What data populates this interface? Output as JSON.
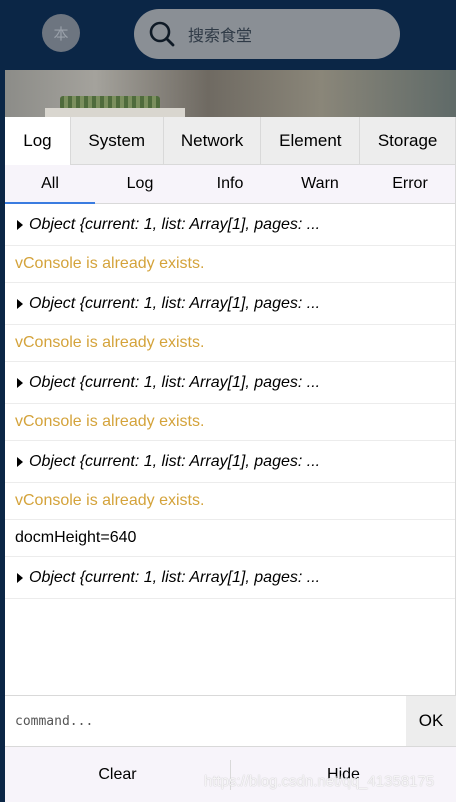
{
  "header": {
    "avatar_glyph": "本",
    "search": {
      "placeholder": "搜索食堂",
      "icon": "search-icon"
    }
  },
  "vconsole": {
    "tabs": [
      {
        "label": "Log",
        "active": true
      },
      {
        "label": "System",
        "active": false
      },
      {
        "label": "Network",
        "active": false
      },
      {
        "label": "Element",
        "active": false
      },
      {
        "label": "Storage",
        "active": false
      }
    ],
    "subtabs": [
      {
        "label": "All",
        "active": true
      },
      {
        "label": "Log",
        "active": false
      },
      {
        "label": "Info",
        "active": false
      },
      {
        "label": "Warn",
        "active": false
      },
      {
        "label": "Error",
        "active": false
      }
    ],
    "logs": [
      {
        "type": "object",
        "text": "Object {current: 1, list: Array[1], pages: ..."
      },
      {
        "type": "warn",
        "text": "vConsole is already exists."
      },
      {
        "type": "object",
        "text": "Object {current: 1, list: Array[1], pages: ..."
      },
      {
        "type": "warn",
        "text": "vConsole is already exists."
      },
      {
        "type": "object",
        "text": "Object {current: 1, list: Array[1], pages: ..."
      },
      {
        "type": "warn",
        "text": "vConsole is already exists."
      },
      {
        "type": "object",
        "text": "Object {current: 1, list: Array[1], pages: ..."
      },
      {
        "type": "warn",
        "text": "vConsole is already exists."
      },
      {
        "type": "plain",
        "text": "docmHeight=640"
      },
      {
        "type": "object",
        "text": "Object {current: 1, list: Array[1], pages: ..."
      }
    ],
    "command": {
      "placeholder": "command...",
      "ok_label": "OK"
    },
    "toolbar": {
      "clear_label": "Clear",
      "hide_label": "Hide"
    },
    "colors": {
      "warn": "#d4a33b",
      "header_bg": "#0b2646",
      "active_underline": "#3a7ce0"
    }
  },
  "watermark": "https://blog.csdn.net/qq_41358175"
}
